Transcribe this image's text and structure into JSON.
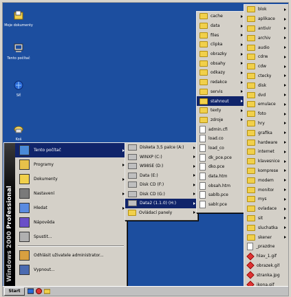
{
  "desktop": {
    "icons": [
      {
        "label": "Moje dokumenty",
        "icon": "documents-icon"
      },
      {
        "label": "Tento počítač",
        "icon": "computer-icon"
      },
      {
        "label": "Síť",
        "icon": "network-icon"
      },
      {
        "label": "Koš",
        "icon": "recycle-bin-icon"
      }
    ]
  },
  "taskbar": {
    "start_label": "Start"
  },
  "start_menu": {
    "banner": {
      "brand": "Windows",
      "version": "2000",
      "edition": "Professional"
    },
    "items": [
      {
        "label": "Tento počítač",
        "icon": "computer-icon",
        "submenu": true
      },
      {
        "label": "Programy",
        "icon": "programs-icon",
        "submenu": true
      },
      {
        "label": "Dokumenty",
        "icon": "documents-icon",
        "submenu": true
      },
      {
        "label": "Nastavení",
        "icon": "settings-icon",
        "submenu": true
      },
      {
        "label": "Hledat",
        "icon": "search-icon",
        "submenu": true
      },
      {
        "label": "Nápověda",
        "icon": "help-icon",
        "submenu": false
      },
      {
        "label": "Spustit...",
        "icon": "run-icon",
        "submenu": false
      },
      {
        "label": "Odhlásit uživatele administrator...",
        "icon": "logoff-icon",
        "submenu": false
      },
      {
        "label": "Vypnout...",
        "icon": "shutdown-icon",
        "submenu": false
      }
    ]
  },
  "drives_menu": {
    "items": [
      {
        "label": "Disketa 3,5 palce (A:)",
        "kind": "drive"
      },
      {
        "label": "WINXP (C:)",
        "kind": "drive"
      },
      {
        "label": "W98SE (D:)",
        "kind": "drive"
      },
      {
        "label": "Data (E:)",
        "kind": "drive"
      },
      {
        "label": "Disk CD (F:)",
        "kind": "drive"
      },
      {
        "label": "Disk CD (G:)",
        "kind": "drive"
      },
      {
        "label": "Data2 (1.1.0) (H:)",
        "kind": "drive"
      },
      {
        "label": "Ovládací panely",
        "kind": "folder"
      }
    ]
  },
  "folders_menu": {
    "items": [
      {
        "label": "cache",
        "kind": "folder"
      },
      {
        "label": "data",
        "kind": "folder"
      },
      {
        "label": "files",
        "kind": "folder"
      },
      {
        "label": "clipka",
        "kind": "folder"
      },
      {
        "label": "obrazky",
        "kind": "folder"
      },
      {
        "label": "obsahy",
        "kind": "folder"
      },
      {
        "label": "odkazy",
        "kind": "folder"
      },
      {
        "label": "redakce",
        "kind": "folder"
      },
      {
        "label": "servis",
        "kind": "folder"
      },
      {
        "label": "stahnout",
        "kind": "folder"
      },
      {
        "label": "texty",
        "kind": "folder"
      },
      {
        "label": "zdroje",
        "kind": "folder"
      },
      {
        "label": "admin.cfi",
        "kind": "file"
      },
      {
        "label": "load.co",
        "kind": "file"
      },
      {
        "label": "load_co",
        "kind": "file"
      },
      {
        "label": "dk_pce.pce",
        "kind": "file"
      },
      {
        "label": "dko.pce",
        "kind": "file"
      },
      {
        "label": "data.htm",
        "kind": "file"
      },
      {
        "label": "obsah.htm",
        "kind": "file"
      },
      {
        "label": "sablb.pce",
        "kind": "file"
      },
      {
        "label": "sablr.pce",
        "kind": "file"
      }
    ]
  },
  "subfolder_menu": {
    "items": [
      {
        "label": "blok",
        "kind": "folder"
      },
      {
        "label": "aplikace",
        "kind": "folder"
      },
      {
        "label": "antivir",
        "kind": "folder"
      },
      {
        "label": "archiv",
        "kind": "folder"
      },
      {
        "label": "audio",
        "kind": "folder"
      },
      {
        "label": "cdrw",
        "kind": "folder"
      },
      {
        "label": "cdw",
        "kind": "folder"
      },
      {
        "label": "ctecky",
        "kind": "folder"
      },
      {
        "label": "disk",
        "kind": "folder"
      },
      {
        "label": "dvd",
        "kind": "folder"
      },
      {
        "label": "emulace",
        "kind": "folder"
      },
      {
        "label": "foto",
        "kind": "folder"
      },
      {
        "label": "hry",
        "kind": "folder"
      },
      {
        "label": "grafika",
        "kind": "folder"
      },
      {
        "label": "hardware",
        "kind": "folder"
      },
      {
        "label": "internet",
        "kind": "folder"
      },
      {
        "label": "klavesnice",
        "kind": "folder"
      },
      {
        "label": "komprese",
        "kind": "folder"
      },
      {
        "label": "modem",
        "kind": "folder"
      },
      {
        "label": "monitor",
        "kind": "folder"
      },
      {
        "label": "mys",
        "kind": "folder"
      },
      {
        "label": "ovladace",
        "kind": "folder"
      },
      {
        "label": "sit",
        "kind": "folder"
      },
      {
        "label": "sluchatka",
        "kind": "folder"
      },
      {
        "label": "skener",
        "kind": "folder"
      },
      {
        "label": "_prazdne",
        "kind": "file"
      },
      {
        "label": "hlav_1.gif",
        "kind": "image"
      },
      {
        "label": "obrazek.gif",
        "kind": "image"
      },
      {
        "label": "stranka.jpg",
        "kind": "image"
      },
      {
        "label": "ikona.gif",
        "kind": "image"
      }
    ]
  }
}
